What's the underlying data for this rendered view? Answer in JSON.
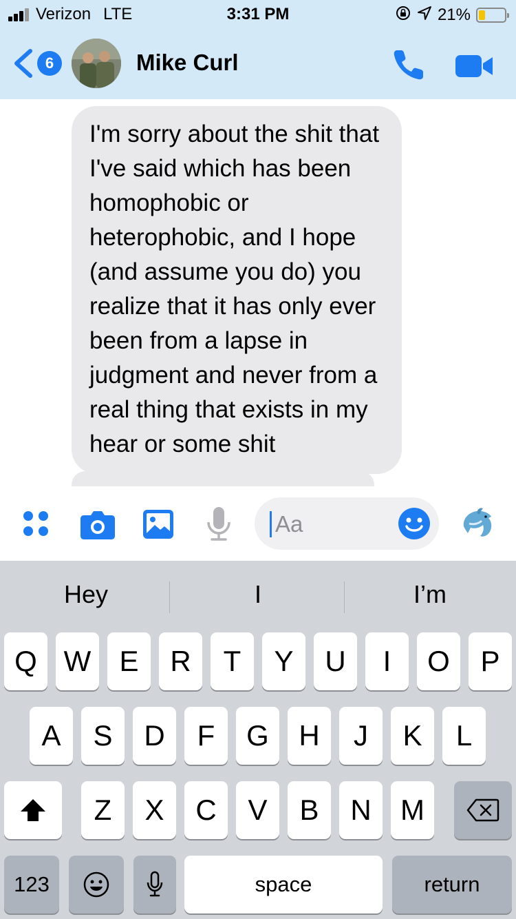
{
  "status_bar": {
    "carrier": "Verizon",
    "network": "LTE",
    "time": "3:31 PM",
    "battery": "21%",
    "battery_level": 0.21
  },
  "nav": {
    "back_badge": "6",
    "contact_name": "Mike Curl"
  },
  "messages": [
    {
      "sender": "contact",
      "text": "I'm sorry about the shit that I've said which has been homophobic or heterophobic, and I hope (and assume you do) you realize that it has only ever been from a lapse in judgment and never from a real thing that exists in my hear or some shit"
    }
  ],
  "composer": {
    "placeholder": "Aa"
  },
  "keyboard": {
    "suggestions": [
      "Hey",
      "I",
      "I’m"
    ],
    "row1": [
      "Q",
      "W",
      "E",
      "R",
      "T",
      "Y",
      "U",
      "I",
      "O",
      "P"
    ],
    "row2": [
      "A",
      "S",
      "D",
      "F",
      "G",
      "H",
      "J",
      "K",
      "L"
    ],
    "row3": [
      "Z",
      "X",
      "C",
      "V",
      "B",
      "N",
      "M"
    ],
    "numbers_label": "123",
    "space_label": "space",
    "return_label": "return"
  },
  "colors": {
    "accent": "#1e7cf2",
    "header_bg": "#d4e9f7",
    "bubble_bg": "#e9e9eb",
    "keyboard_bg": "#d1d4d9"
  }
}
